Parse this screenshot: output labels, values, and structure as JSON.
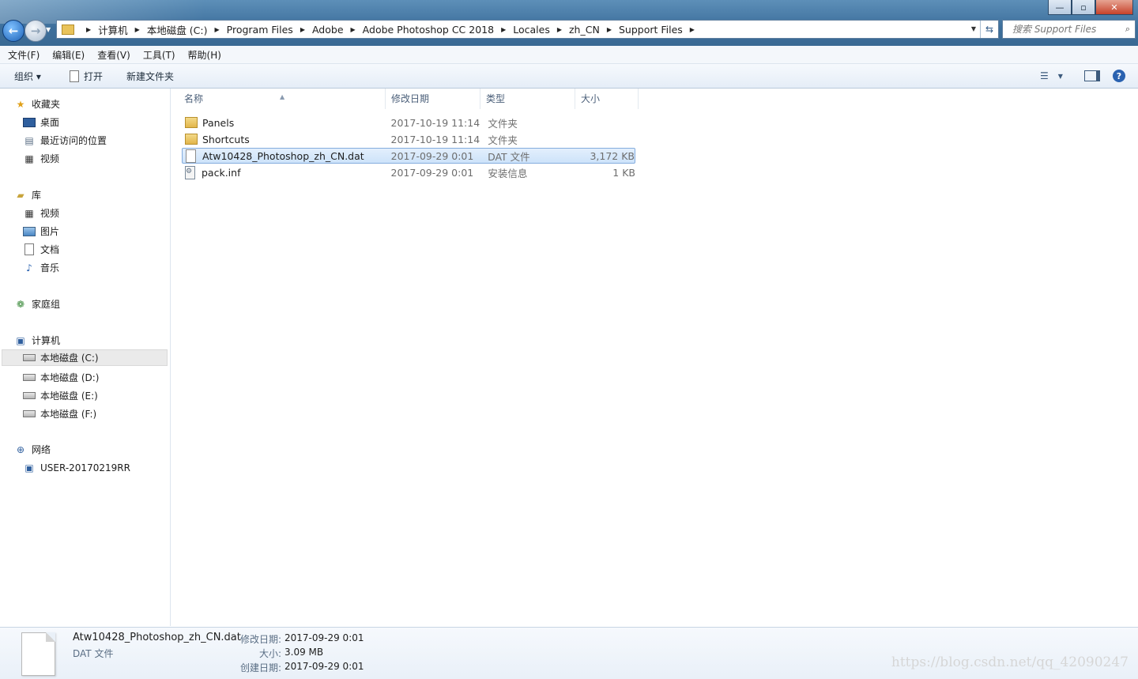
{
  "window": {
    "minimize_glyph": "—",
    "maximize_glyph": "▫",
    "close_glyph": "✕"
  },
  "address": {
    "crumbs": [
      "计算机",
      "本地磁盘 (C:)",
      "Program Files",
      "Adobe",
      "Adobe Photoshop CC 2018",
      "Locales",
      "zh_CN",
      "Support Files"
    ]
  },
  "search": {
    "placeholder": "搜索 Support Files"
  },
  "menu": {
    "items": [
      "文件(F)",
      "编辑(E)",
      "查看(V)",
      "工具(T)",
      "帮助(H)"
    ]
  },
  "toolbar": {
    "organize_label": "组织 ▾",
    "open_label": "打开",
    "new_folder_label": "新建文件夹"
  },
  "sidebar": {
    "favorites": {
      "label": "收藏夹",
      "items": [
        "桌面",
        "最近访问的位置",
        "视频"
      ]
    },
    "libraries": {
      "label": "库",
      "items": [
        "视频",
        "图片",
        "文档",
        "音乐"
      ]
    },
    "homegroup": {
      "label": "家庭组"
    },
    "computer": {
      "label": "计算机",
      "items": [
        "本地磁盘 (C:)",
        "本地磁盘 (D:)",
        "本地磁盘 (E:)",
        "本地磁盘 (F:)"
      ]
    },
    "network": {
      "label": "网络",
      "items": [
        "USER-20170219RR"
      ]
    }
  },
  "columns": {
    "name": "名称",
    "date": "修改日期",
    "type": "类型",
    "size": "大小"
  },
  "files": [
    {
      "name": "Panels",
      "date": "2017-10-19 11:14",
      "type": "文件夹",
      "size": "",
      "icon": "folder-icon"
    },
    {
      "name": "Shortcuts",
      "date": "2017-10-19 11:14",
      "type": "文件夹",
      "size": "",
      "icon": "folder-icon"
    },
    {
      "name": "Atw10428_Photoshop_zh_CN.dat",
      "date": "2017-09-29 0:01",
      "type": "DAT 文件",
      "size": "3,172 KB",
      "icon": "file-icon",
      "selected": true
    },
    {
      "name": "pack.inf",
      "date": "2017-09-29 0:01",
      "type": "安装信息",
      "size": "1 KB",
      "icon": "inf-file-icon"
    }
  ],
  "details": {
    "name": "Atw10428_Photoshop_zh_CN.dat",
    "type": "DAT 文件",
    "modified_label": "修改日期:",
    "modified_value": "2017-09-29 0:01",
    "size_label": "大小:",
    "size_value": "3.09 MB",
    "created_label": "创建日期:",
    "created_value": "2017-09-29 0:01"
  },
  "watermark": "https://blog.csdn.net/qq_42090247"
}
